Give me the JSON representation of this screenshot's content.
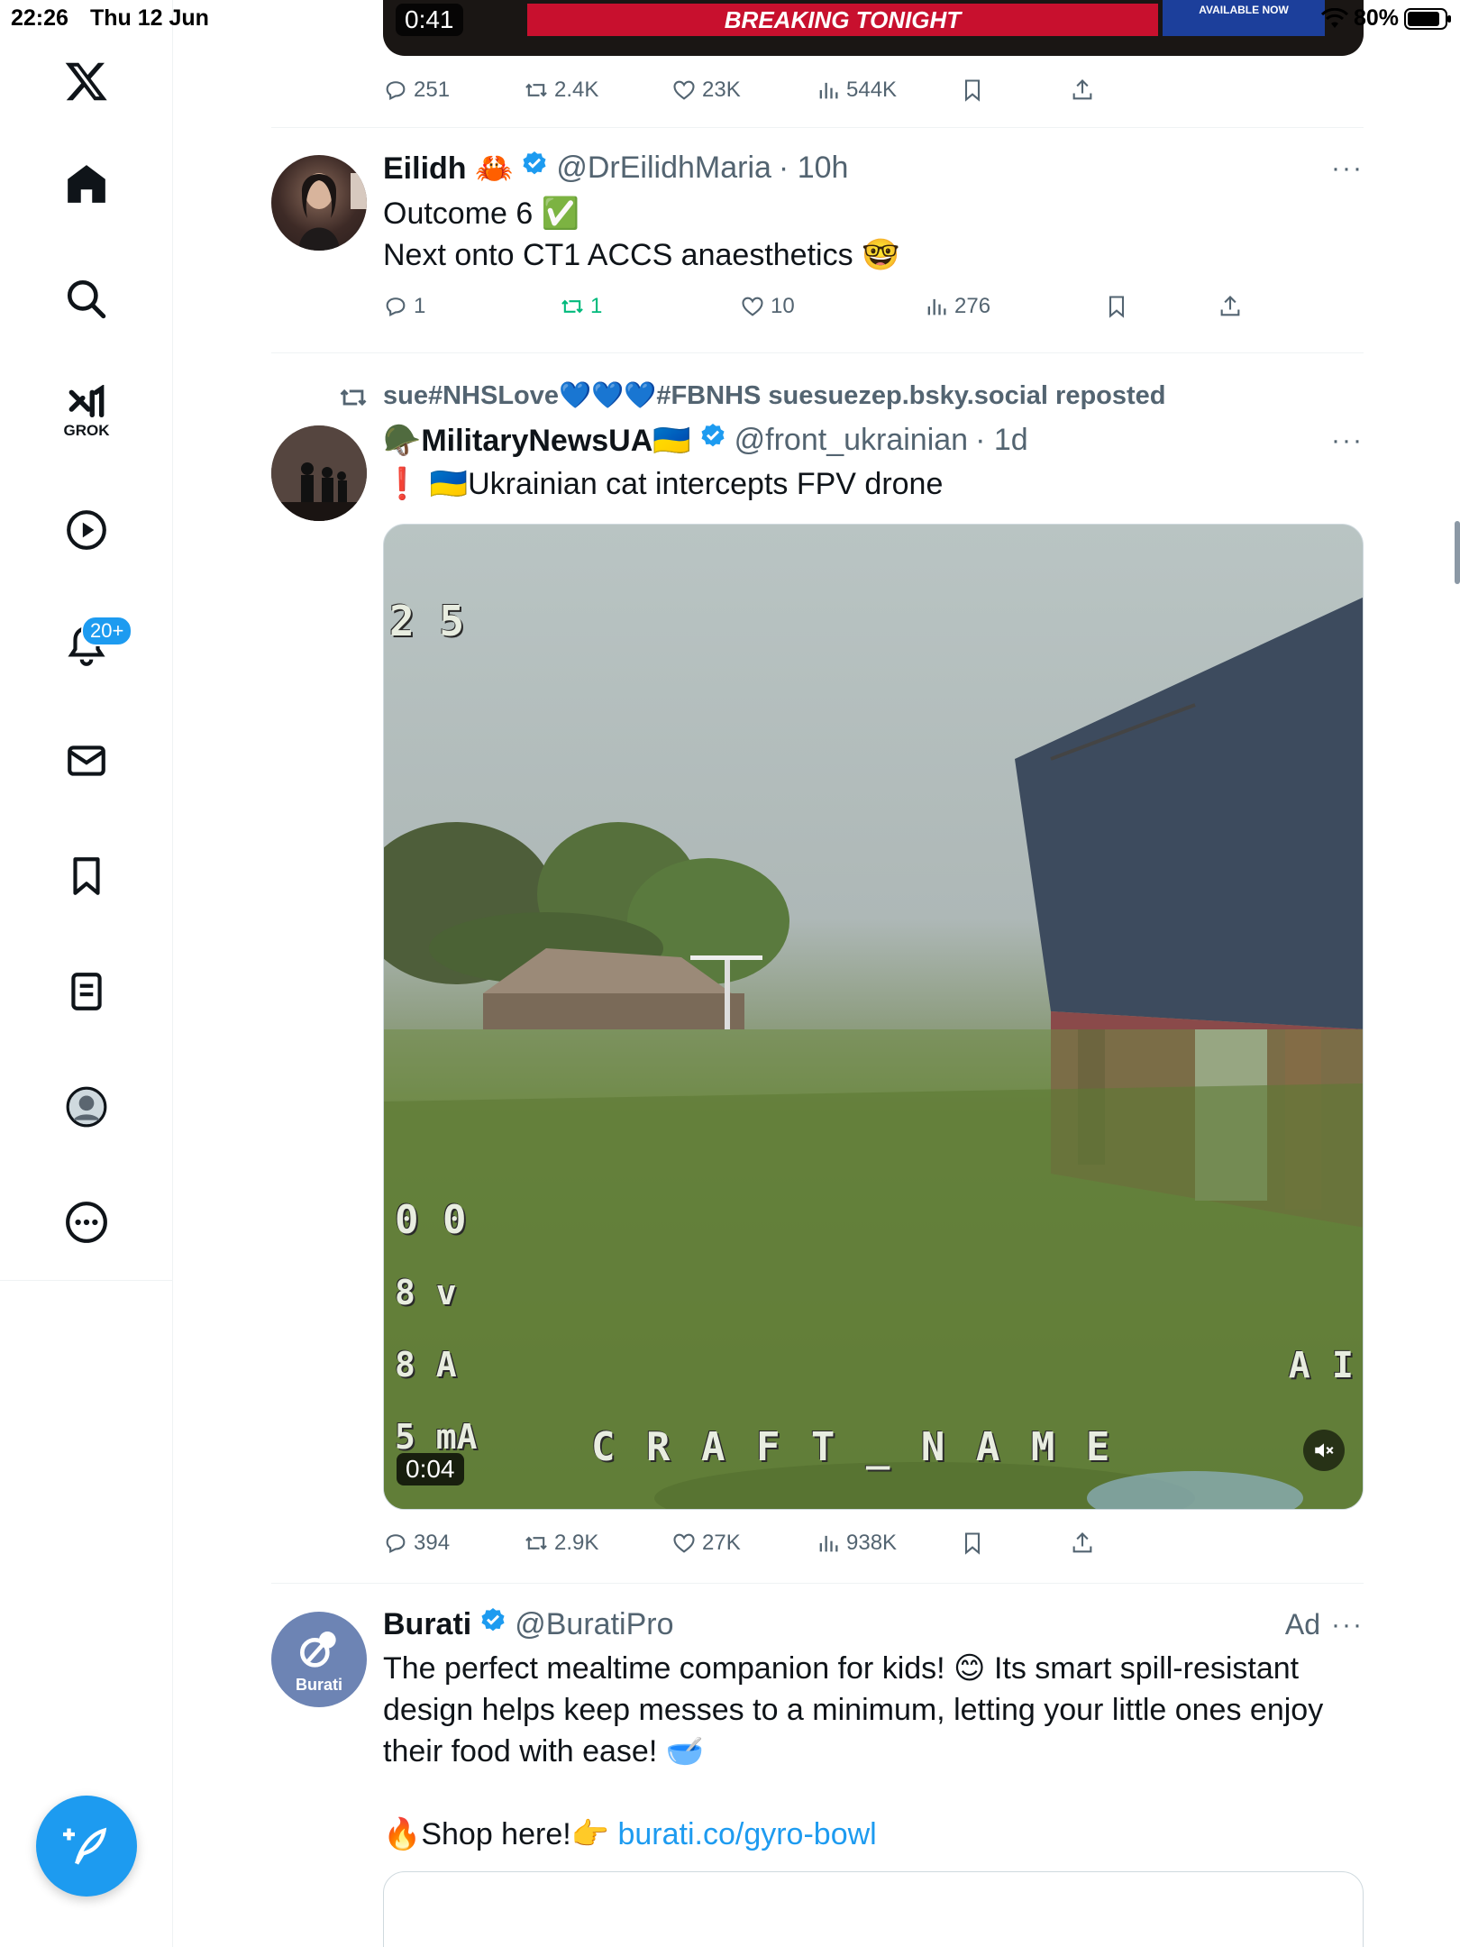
{
  "status_bar": {
    "time": "22:26",
    "date": "Thu 12 Jun",
    "battery": "80%"
  },
  "sidebar": {
    "items": [
      {
        "name": "x-logo"
      },
      {
        "name": "home"
      },
      {
        "name": "search"
      },
      {
        "name": "grok",
        "label": "GROK"
      },
      {
        "name": "video"
      },
      {
        "name": "notifications",
        "badge": "20+"
      },
      {
        "name": "messages"
      },
      {
        "name": "bookmarks"
      },
      {
        "name": "lists"
      },
      {
        "name": "profile"
      },
      {
        "name": "more"
      }
    ]
  },
  "tweets": [
    {
      "video": {
        "duration": "0:41",
        "banner_text": "BREAKING TONIGHT",
        "side_banner": "AVAILABLE NOW"
      },
      "actions": {
        "replies": "251",
        "reposts": "2.4K",
        "likes": "23K",
        "views": "544K"
      }
    },
    {
      "name": "Eilidh 🦀",
      "handle": "@DrEilidhMaria",
      "time": "· 10h",
      "more": "···",
      "lines": [
        "Outcome 6 ✅",
        "Next onto CT1 ACCS anaesthetics 🤓"
      ],
      "actions": {
        "replies": "1",
        "reposts": "1",
        "likes": "10",
        "views": "276"
      }
    },
    {
      "repost_by": "sue#NHSLove💙💙💙#FBNHS suesuezep.bsky.social reposted",
      "name": "🪖MilitaryNewsUA🇺🇦",
      "handle": "@front_ukrainian",
      "time": "· 1d",
      "more": "···",
      "text": "❗ 🇺🇦Ukrainian cat intercepts FPV drone",
      "video": {
        "duration": "0:04",
        "osd_top": "2 5",
        "osd_left": [
          "0 0",
          "8 v",
          "8 A",
          "5 mA"
        ],
        "osd_bottom": "C R A F T _ N A M E",
        "osd_right": [
          "A I"
        ]
      },
      "actions": {
        "replies": "394",
        "reposts": "2.9K",
        "likes": "27K",
        "views": "938K"
      }
    },
    {
      "name": "Burati",
      "handle": "@BuratiPro",
      "ad": "Ad",
      "more": "···",
      "avatar_text": "Burati",
      "lines": [
        "The perfect mealtime companion for kids! 😊 Its smart spill-resistant",
        "design helps keep messes to a minimum, letting your little ones enjoy",
        "their food with ease! 🥣"
      ],
      "shop_text": "🔥Shop here!👉",
      "link": "burati.co/gyro-bowl"
    }
  ],
  "colors": {
    "accent": "#1d9bf0",
    "repost_green": "#00ba7c",
    "muted": "#536471"
  }
}
